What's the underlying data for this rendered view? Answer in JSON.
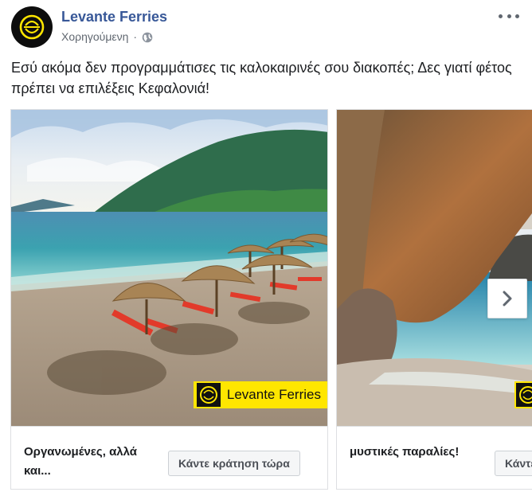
{
  "post": {
    "page_name": "Levante Ferries",
    "sponsored_label": "Χορηγούμενη",
    "separator": "·",
    "privacy_icon": "globe-icon",
    "more_icon": "more-options-icon",
    "text": "Εσύ ακόμα δεν προγραμμάτισες τις καλοκαιρινές σου διακοπές; Δες γιατί φέτος πρέπει να επιλέξεις Κεφαλονιά!"
  },
  "carousel": {
    "cards": [
      {
        "image_alt": "beach-with-straw-umbrellas",
        "brand_text": "Levante Ferries",
        "title": "Οργανωμένες, αλλά και...",
        "cta": "Κάντε κράτηση τώρα"
      },
      {
        "image_alt": "rocky-cave-beach",
        "brand_text": "",
        "title": "μυστικές παραλίες!",
        "cta": "Κάντε κράτηση τώρα"
      }
    ],
    "next_icon": "chevron-right-icon"
  },
  "colors": {
    "page_name": "#385898",
    "brand_yellow": "#ffe600",
    "muted_text": "#606770"
  }
}
